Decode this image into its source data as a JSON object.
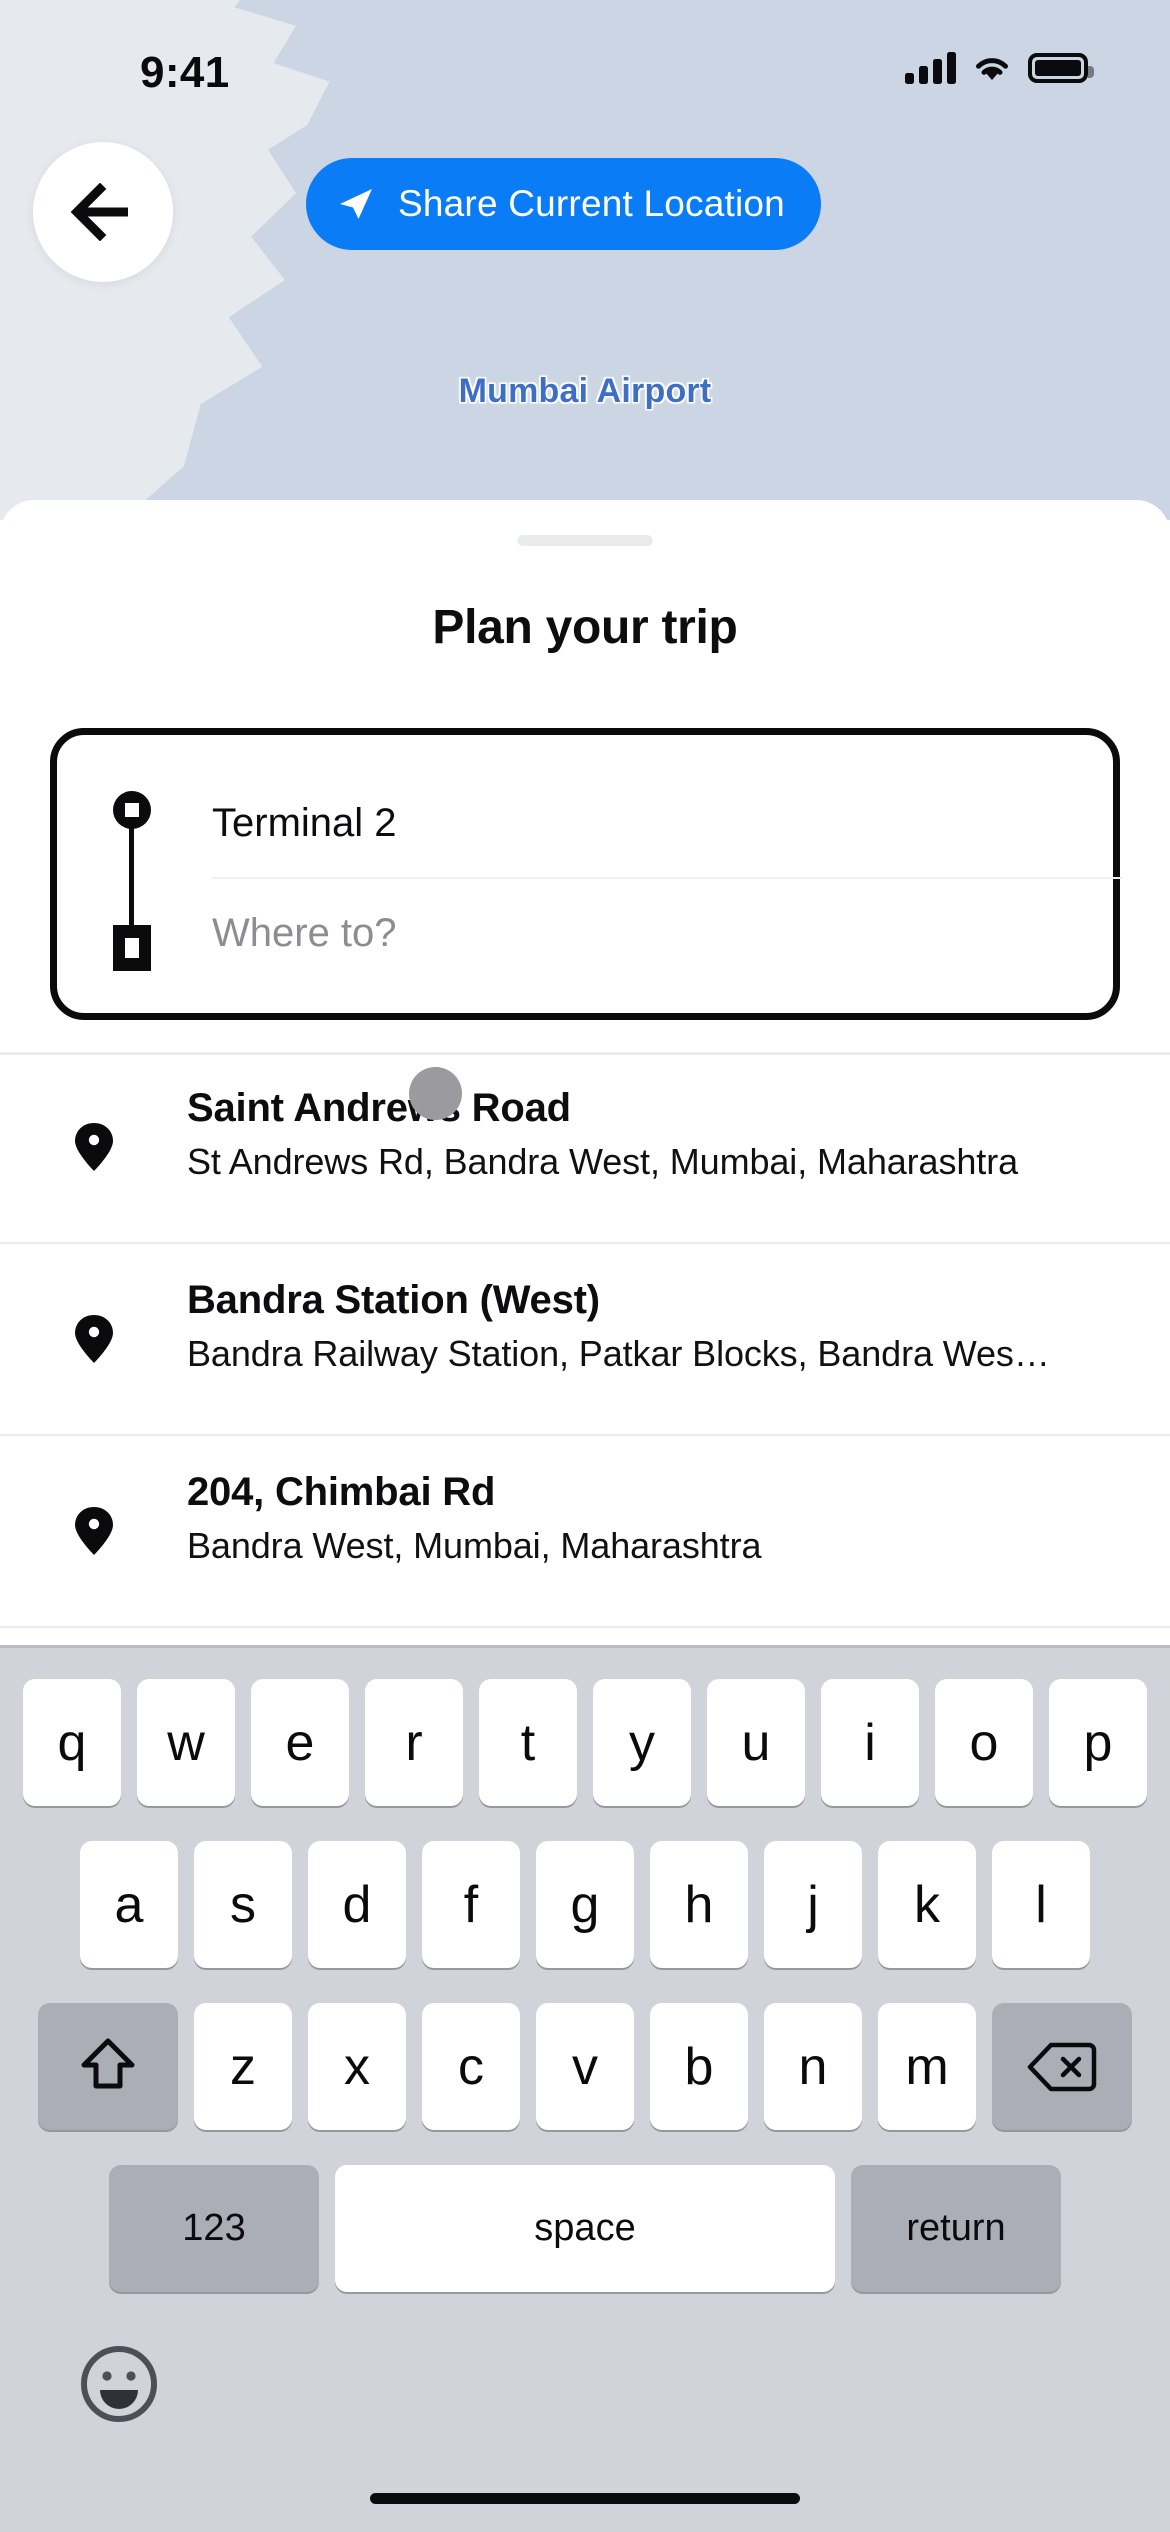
{
  "status_bar": {
    "time": "9:41",
    "signal_icon": "cellular-signal-icon",
    "wifi_icon": "wifi-icon",
    "battery_icon": "battery-icon"
  },
  "map": {
    "label": "Mumbai Airport",
    "water_color": "#ccd5e3",
    "land_color": "#e6e9ee",
    "label_color": "#3f6fc4"
  },
  "top_controls": {
    "back_icon": "arrow-left-icon",
    "share_icon": "navigation-arrow-icon",
    "share_label": "Share Current Location",
    "share_color": "#0a7cf6"
  },
  "sheet": {
    "title": "Plan your trip"
  },
  "route": {
    "origin_value": "Terminal 2",
    "destination_value": "",
    "destination_placeholder": "Where to?",
    "origin_marker": "circle-origin-icon",
    "destination_marker": "square-destination-icon"
  },
  "suggestions": [
    {
      "icon": "map-pin-icon",
      "title": "Saint Andrews Road",
      "subtitle": "St Andrews Rd, Bandra West, Mumbai, Maharashtra"
    },
    {
      "icon": "map-pin-icon",
      "title": "Bandra Station (West)",
      "subtitle": "Bandra Railway Station, Patkar Blocks, Bandra Wes…"
    },
    {
      "icon": "map-pin-icon",
      "title": "204, Chimbai Rd",
      "subtitle": "Bandra West, Mumbai, Maharashtra"
    }
  ],
  "keyboard": {
    "row1": [
      "q",
      "w",
      "e",
      "r",
      "t",
      "y",
      "u",
      "i",
      "o",
      "p"
    ],
    "row2": [
      "a",
      "s",
      "d",
      "f",
      "g",
      "h",
      "j",
      "k",
      "l"
    ],
    "row3": [
      "z",
      "x",
      "c",
      "v",
      "b",
      "n",
      "m"
    ],
    "shift_icon": "shift-arrow-up-icon",
    "backspace_icon": "backspace-delete-icon",
    "numbers_label": "123",
    "space_label": "space",
    "return_label": "return",
    "emoji_icon": "emoji-smiley-icon",
    "key_color": "#ffffff",
    "mod_key_color": "#abaeb6",
    "background_color": "#d0d3d9"
  }
}
